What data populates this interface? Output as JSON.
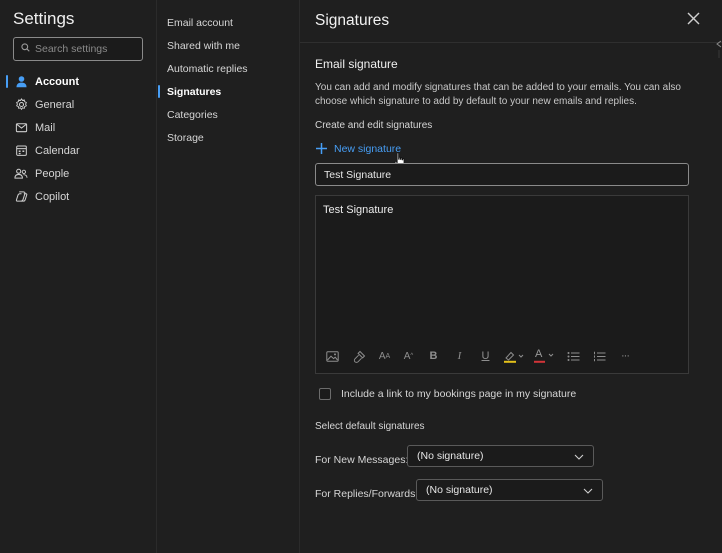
{
  "app": {
    "title": "Settings"
  },
  "search": {
    "placeholder": "Search settings",
    "value": ""
  },
  "nav": {
    "items": [
      {
        "label": "Account",
        "icon": "person-icon",
        "active": true
      },
      {
        "label": "General",
        "icon": "gear-icon"
      },
      {
        "label": "Mail",
        "icon": "mail-icon"
      },
      {
        "label": "Calendar",
        "icon": "calendar-icon"
      },
      {
        "label": "People",
        "icon": "people-icon"
      },
      {
        "label": "Copilot",
        "icon": "copilot-icon"
      }
    ]
  },
  "subnav": {
    "items": [
      {
        "label": "Email account"
      },
      {
        "label": "Shared with me"
      },
      {
        "label": "Automatic replies"
      },
      {
        "label": "Signatures",
        "active": true
      },
      {
        "label": "Categories"
      },
      {
        "label": "Storage"
      }
    ]
  },
  "pane": {
    "title": "Signatures",
    "section_title": "Email signature",
    "description": "You can add and modify signatures that can be added to your emails. You can also choose which signature to add by default to your new emails and replies.",
    "create_title": "Create and edit signatures",
    "new_signature_label": "New signature",
    "signature_name": "Test Signature",
    "editor_text": "Test Signature",
    "bookings_label": "Include a link to my bookings page in my signature",
    "bookings_checked": false,
    "defaults_title": "Select default signatures",
    "new_messages_label": "For New Messages:",
    "new_messages_value": "(No signature)",
    "replies_label": "For Replies/Forwards:",
    "replies_value": "(No signature)"
  },
  "toolbar": {
    "font_size_glyph": "A",
    "font_size_sup": "A",
    "bold": "B",
    "italic": "I",
    "underline": "U",
    "font_color_glyph": "A",
    "more": "···"
  },
  "colors": {
    "accent": "#479ef5",
    "background": "#1f1f1f",
    "highlight_yellow": "#e3c01a",
    "font_color_red": "#d13438"
  }
}
